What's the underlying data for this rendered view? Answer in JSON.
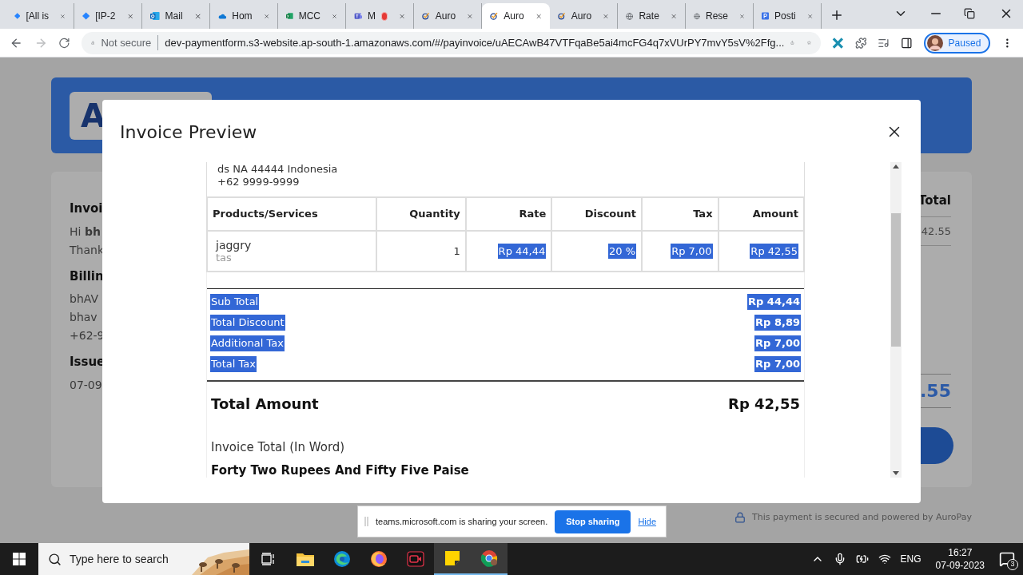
{
  "browser": {
    "tabs": [
      {
        "title": "[All is",
        "kind": "diamond",
        "recording": false,
        "selected": false
      },
      {
        "title": "[IP-2",
        "kind": "diamond",
        "recording": false,
        "selected": false
      },
      {
        "title": "Mail",
        "kind": "mail",
        "recording": false,
        "selected": false
      },
      {
        "title": "Hom",
        "kind": "cloud",
        "recording": false,
        "selected": false
      },
      {
        "title": "MCC",
        "kind": "sheet",
        "recording": false,
        "selected": false
      },
      {
        "title": "M",
        "kind": "people",
        "recording": true,
        "selected": false
      },
      {
        "title": "Auro",
        "kind": "check",
        "recording": false,
        "selected": false
      },
      {
        "title": "Auro",
        "kind": "check",
        "recording": false,
        "selected": true
      },
      {
        "title": "Auro",
        "kind": "check",
        "recording": false,
        "selected": false
      },
      {
        "title": "Rate",
        "kind": "globe",
        "recording": false,
        "selected": false
      },
      {
        "title": "Rese",
        "kind": "globe",
        "recording": false,
        "selected": false
      },
      {
        "title": "Posti",
        "kind": "square",
        "recording": false,
        "selected": false
      }
    ],
    "security": "Not secure",
    "url": "dev-paymentform.s3-website.ap-south-1.amazonaws.com/#/payinvoice/uAECAwB47VTFqaBe5ai4mcFG4q7xVUrPY7mvY5sV%2Ffg...",
    "profile": "Paused"
  },
  "background_page": {
    "logo_letter": "A",
    "left": [
      {
        "text": "Invoi",
        "kind": "heading"
      },
      {
        "text": "Hi **bh**",
        "kind": "body"
      },
      {
        "text": "Thank",
        "kind": "body"
      },
      {
        "text": "Billin",
        "kind": "heading"
      },
      {
        "text": "bhAV",
        "kind": "body"
      },
      {
        "text": "bhav",
        "kind": "body"
      },
      {
        "text": "+62-9",
        "kind": "body"
      },
      {
        "text": "Issue",
        "kind": "heading"
      },
      {
        "text": "07-09",
        "kind": "body"
      }
    ],
    "total_heading": "Total",
    "total_row": "42.55",
    "grand_total": ".55",
    "footer": "This payment is secured and powered by AuroPay"
  },
  "modal": {
    "title": "Invoice Preview",
    "address_lines": [
      "ds NA 44444 Indonesia",
      "+62 9999-9999"
    ],
    "table": {
      "columns": [
        "Products/Services",
        "Quantity",
        "Rate",
        "Discount",
        "Tax",
        "Amount"
      ],
      "rows": [
        {
          "cells": [
            {
              "text": "jaggry",
              "description": "tas",
              "highlighted": false
            },
            {
              "text": "1",
              "highlighted": false
            },
            {
              "text": "Rp 44,44",
              "highlighted": true
            },
            {
              "text": "20 %",
              "highlighted": true
            },
            {
              "text": "Rp 7,00",
              "highlighted": true
            },
            {
              "text": "Rp 42,55",
              "highlighted": true
            }
          ]
        }
      ]
    },
    "summary": [
      {
        "label": "Sub Total",
        "value": "Rp 44,44",
        "highlighted": true
      },
      {
        "label": "Total Discount",
        "value": "Rp 8,89",
        "highlighted": true
      },
      {
        "label": "Additional Tax",
        "value": "Rp 7,00",
        "highlighted": true
      },
      {
        "label": "Total Tax",
        "value": "Rp 7,00",
        "highlighted": true
      }
    ],
    "total": {
      "label": "Total Amount",
      "value": "Rp 42,55"
    },
    "words_label": "Invoice Total (In Word)",
    "words": "Forty Two Rupees And Fifty Five Paise"
  },
  "sharing_bar": {
    "message": "teams.microsoft.com is sharing your screen.",
    "stop": "Stop sharing",
    "hide": "Hide"
  },
  "taskbar": {
    "search_placeholder": "Type here to search",
    "apps": [
      {
        "kind": "taskview",
        "active": false
      },
      {
        "kind": "folder",
        "active": false
      },
      {
        "kind": "edge",
        "active": false
      },
      {
        "kind": "firefox",
        "active": false
      },
      {
        "kind": "recorder",
        "active": false
      },
      {
        "kind": "notes",
        "active": true
      },
      {
        "kind": "chrome",
        "active": true
      }
    ],
    "language": "ENG",
    "time": "16:27",
    "date": "07-09-2023",
    "notifications": "3"
  }
}
